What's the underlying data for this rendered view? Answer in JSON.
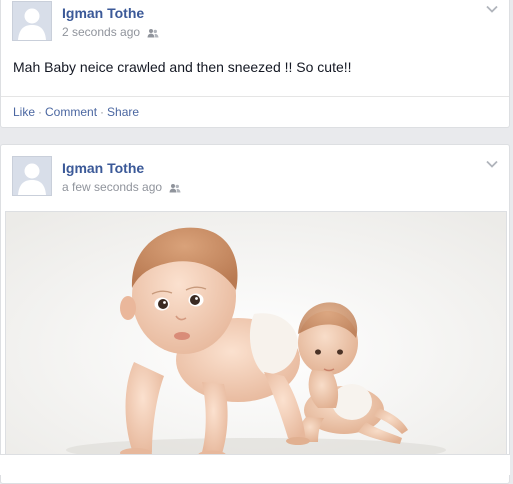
{
  "posts": [
    {
      "author": "Igman Tothe",
      "time": "2 seconds ago",
      "audience_icon": "friends-icon",
      "text": "Mah Baby neice crawled and then sneezed !! So cute!!",
      "actions": [
        "Like",
        "Comment",
        "Share"
      ],
      "action_separator": "·"
    },
    {
      "author": "Igman Tothe",
      "time": "a few seconds ago",
      "audience_icon": "friends-icon",
      "photo": "crawling-babies-photo"
    }
  ],
  "colors": {
    "link": "#3b5998",
    "action_link": "#4b67a1",
    "meta_text": "#90949c",
    "feed_background": "#e9eaed"
  }
}
